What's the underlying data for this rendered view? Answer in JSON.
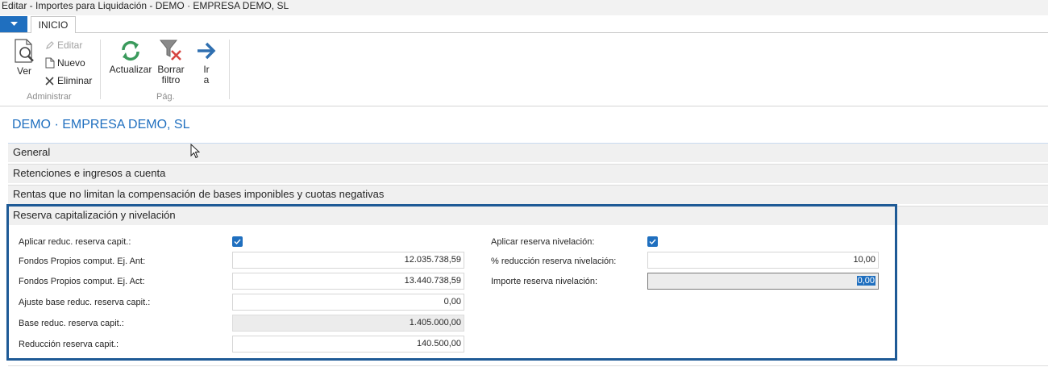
{
  "window": {
    "title": "Editar - Importes para Liquidación - DEMO · EMPRESA DEMO, SL"
  },
  "ribbon": {
    "tab": "INICIO",
    "groups": {
      "administrar": {
        "label": "Administrar",
        "ver": "Ver",
        "editar": "Editar",
        "nuevo": "Nuevo",
        "eliminar": "Eliminar"
      },
      "pag": {
        "label": "Pág.",
        "actualizar": "Actualizar",
        "borrar_filtro_1": "Borrar",
        "borrar_filtro_2": "filtro",
        "ir_a_1": "Ir",
        "ir_a_2": "a"
      }
    }
  },
  "company": "DEMO · EMPRESA DEMO, SL",
  "fasttabs": {
    "general": "General",
    "retenciones": "Retenciones e ingresos a cuenta",
    "rentas": "Rentas que no limitan la compensación de bases imponibles y cuotas negativas",
    "reserva": "Reserva capitalización y nivelación"
  },
  "reserva": {
    "aplicar_capit_label": "Aplicar reduc. reserva capit.:",
    "aplicar_capit_checked": true,
    "fondos_ant_label": "Fondos Propios comput. Ej. Ant:",
    "fondos_ant_value": "12.035.738,59",
    "fondos_act_label": "Fondos Propios comput. Ej. Act:",
    "fondos_act_value": "13.440.738,59",
    "ajuste_label": "Ajuste base reduc. reserva capit.:",
    "ajuste_value": "0,00",
    "base_label": "Base reduc. reserva capit.:",
    "base_value": "1.405.000,00",
    "reduccion_label": "Reducción reserva capit.:",
    "reduccion_value": "140.500,00",
    "aplicar_niv_label": "Aplicar reserva nivelación:",
    "aplicar_niv_checked": true,
    "pct_niv_label": "% reducción reserva nivelación:",
    "pct_niv_value": "10,00",
    "importe_niv_label": "Importe reserva nivelación:",
    "importe_niv_value": "0,00"
  },
  "colors": {
    "accent": "#1f6fbf",
    "section_border": "#1e5a96",
    "ribbon_green": "#3a9a5c",
    "delete_red": "#d64541"
  }
}
